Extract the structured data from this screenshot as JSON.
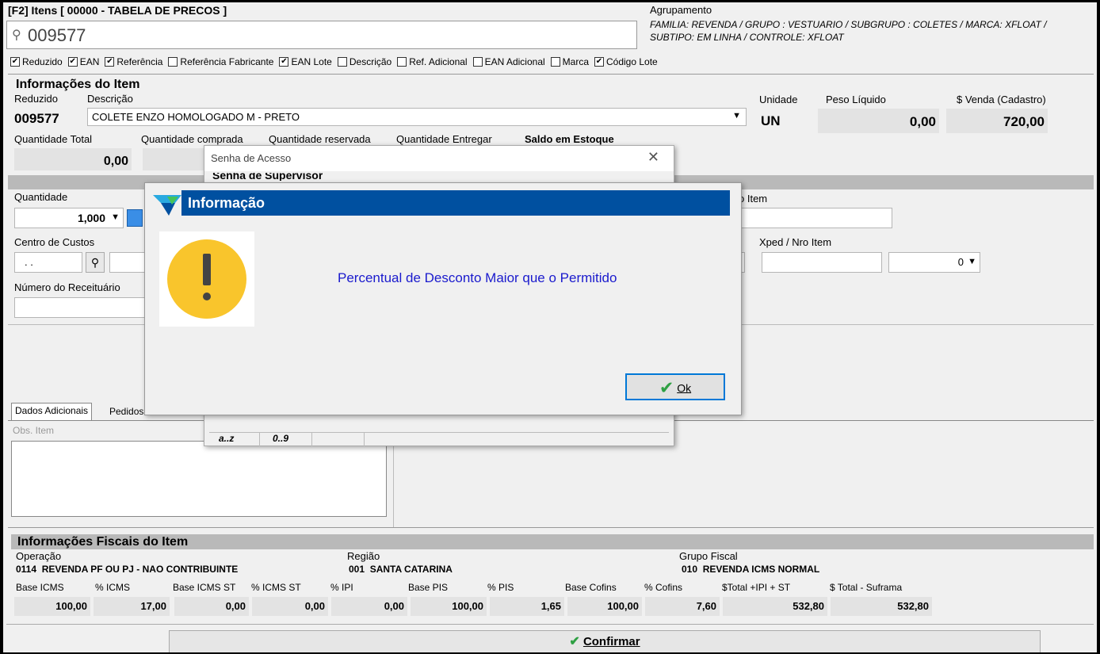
{
  "header": {
    "title": "[F2] Itens [ 00000 - TABELA DE PRECOS ]",
    "search_value": "009577",
    "agrupamento_label": "Agrupamento",
    "agrupamento_line1": "FAMILIA: REVENDA / GRUPO : VESTUARIO / SUBGRUPO : COLETES / MARCA: XFLOAT /",
    "agrupamento_line2": "SUBTIPO: EM LINHA / CONTROLE: XFLOAT"
  },
  "filters": [
    {
      "label": "Reduzido",
      "checked": true
    },
    {
      "label": "EAN",
      "checked": true
    },
    {
      "label": "Referência",
      "checked": true
    },
    {
      "label": "Referência Fabricante",
      "checked": false
    },
    {
      "label": "EAN Lote",
      "checked": true
    },
    {
      "label": "Descrição",
      "checked": false
    },
    {
      "label": "Ref. Adicional",
      "checked": false
    },
    {
      "label": "EAN Adicional",
      "checked": false
    },
    {
      "label": "Marca",
      "checked": false
    },
    {
      "label": "Código Lote",
      "checked": true
    }
  ],
  "item": {
    "section_title": "Informações do Item",
    "reduzido_label": "Reduzido",
    "reduzido_value": "009577",
    "descricao_label": "Descrição",
    "descricao_value": "COLETE ENZO HOMOLOGADO M - PRETO",
    "unidade_label": "Unidade",
    "unidade_value": "UN",
    "peso_label": "Peso Líquido",
    "peso_value": "0,00",
    "venda_label": "$ Venda (Cadastro)",
    "venda_value": "720,00",
    "qtd_total_label": "Quantidade Total",
    "qtd_total_value": "0,00",
    "qtd_comprada_label": "Quantidade comprada",
    "qtd_reservada_label": "Quantidade reservada",
    "qtd_entregar_label": "Quantidade Entregar",
    "saldo_label": "Saldo em Estoque"
  },
  "form": {
    "quantidade_label": "Quantidade",
    "quantidade_value": "1,000",
    "item_label_partial": "o Item",
    "centro_label": "Centro de Custos",
    "centro_value": ". .",
    "xped_label": "Xped / Nro Item",
    "xped_select": "0",
    "receituario_label": "Número do Receituário"
  },
  "tabs": {
    "tab1": "Dados Adicionais",
    "tab2": "Pedidos de Venda",
    "obs_placeholder": "Obs. Item"
  },
  "fiscal": {
    "title": "Informações Fiscais do Item",
    "operacao_label": "Operação",
    "operacao_value": "0114  REVENDA PF OU PJ - NAO CONTRIBUINTE",
    "regiao_label": "Região",
    "regiao_value": "001  SANTA CATARINA",
    "grupo_label": "Grupo Fiscal",
    "grupo_value": "010  REVENDA ICMS NORMAL",
    "columns": [
      {
        "label": "Base ICMS",
        "value": "100,00"
      },
      {
        "label": "% ICMS",
        "value": "17,00"
      },
      {
        "label": "Base ICMS ST",
        "value": "0,00"
      },
      {
        "label": "% ICMS ST",
        "value": "0,00"
      },
      {
        "label": "% IPI",
        "value": "0,00"
      },
      {
        "label": "Base PIS",
        "value": "100,00"
      },
      {
        "label": "% PIS",
        "value": "1,65"
      },
      {
        "label": "Base Cofins",
        "value": "100,00"
      },
      {
        "label": "% Cofins",
        "value": "7,60"
      },
      {
        "label": "$Total +IPI + ST",
        "value": "532,80"
      },
      {
        "label": "$ Total - Suframa",
        "value": "532,80"
      }
    ]
  },
  "confirm_label": "Confirmar",
  "senha_dialog": {
    "title": "Senha de Acesso",
    "partial_text": "Senha de Supervisor",
    "status1": "a..z",
    "status2": "0..9"
  },
  "info_dialog": {
    "title": "Informação",
    "message": "Percentual de Desconto Maior que o Permitido",
    "ok_label": "Ok"
  },
  "colors": {
    "dialog_title_bg": "#0050a0",
    "message_text": "#1a1acd",
    "warning_icon": "#f9c52c",
    "check_green": "#2ea043"
  }
}
